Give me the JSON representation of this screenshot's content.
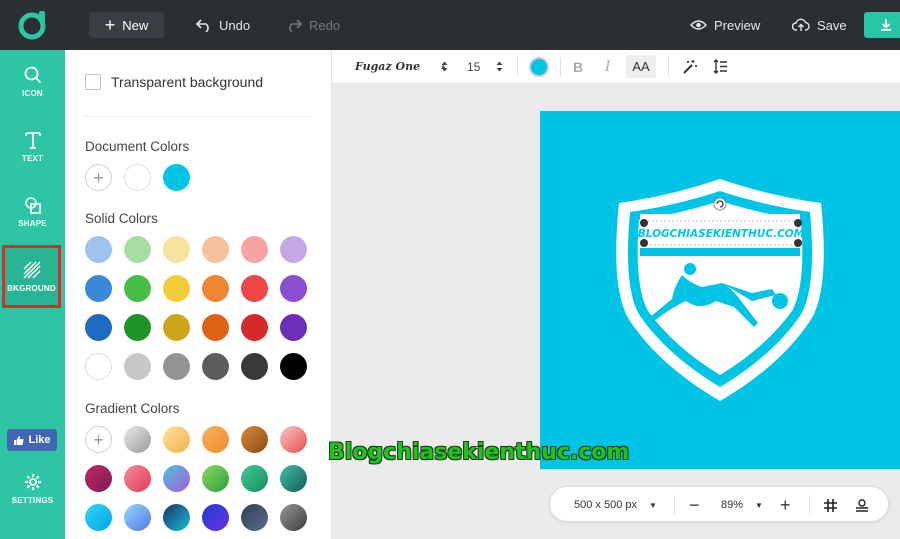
{
  "topbar": {
    "new_label": "New",
    "undo_label": "Undo",
    "redo_label": "Redo",
    "preview_label": "Preview",
    "save_label": "Save",
    "accent_color": "#26c6a6"
  },
  "rail": {
    "items": [
      {
        "label": "ICON",
        "icon": "search-icon"
      },
      {
        "label": "TEXT",
        "icon": "text-icon"
      },
      {
        "label": "SHAPE",
        "icon": "shape-icon"
      },
      {
        "label": "BKGROUND",
        "icon": "background-icon"
      }
    ],
    "like_label": "Like",
    "settings_label": "SETTINGS"
  },
  "panel": {
    "transparent_label": "Transparent background",
    "document_colors_title": "Document Colors",
    "document_colors": [
      "#ffffff",
      "#00c4e6"
    ],
    "solid_colors_title": "Solid Colors",
    "solid_colors": [
      [
        "#9fc3ee",
        "#a6dea1",
        "#f8e2a0",
        "#f7c19d",
        "#f7a3a3",
        "#c4a8e6"
      ],
      [
        "#3b88d8",
        "#46bd46",
        "#f1cd3c",
        "#ee8733",
        "#ec4646",
        "#8a4fcf"
      ],
      [
        "#1f6bbf",
        "#1f9323",
        "#cca71c",
        "#dd6314",
        "#d52a2a",
        "#6a2fb5"
      ],
      [
        "#ffffff",
        "#c8c8c8",
        "#939393",
        "#5c5c5c",
        "#3a3a3a",
        "#000000"
      ]
    ],
    "gradient_colors_title": "Gradient Colors",
    "gradient_colors": [
      [
        null,
        [
          "#e8e8e8",
          "#9a9a9a"
        ],
        [
          "#fde2a0",
          "#f5b04c"
        ],
        [
          "#f7b15d",
          "#ef8d2c"
        ],
        [
          "#d88a3a",
          "#8b4a14"
        ],
        [
          "#f7c9c9",
          "#e84a4a"
        ]
      ],
      [
        [
          "#c2255c",
          "#7a1f5c"
        ],
        [
          "#f78b9a",
          "#e03a5a"
        ],
        [
          "#45c4e0",
          "#b05ad5"
        ],
        [
          "#8fd65e",
          "#2aa03d"
        ],
        [
          "#41cc9a",
          "#1a8a5a"
        ],
        [
          "#3fbfa1",
          "#155a5a"
        ]
      ],
      [
        [
          "#2fd6f5",
          "#00a5e6"
        ],
        [
          "#9ad4f7",
          "#4a7ae8"
        ],
        [
          "#1c2f6b",
          "#18c0d6"
        ],
        [
          "#1c3fd4",
          "#6b2fe0"
        ],
        [
          "#2d3e56",
          "#5a6d8a"
        ],
        [
          "#9a9a9a",
          "#3a3a3a"
        ]
      ]
    ]
  },
  "toolbar": {
    "font_name": "Fugaz One",
    "font_size": "15",
    "text_color": "#00c4e6",
    "bold_label": "B",
    "italic_label": "I",
    "case_label": "AA"
  },
  "canvas": {
    "background_color": "#00c4e6",
    "badge_text": "BLOGCHIASEKIENTHUC.COM",
    "watermark": "Blogchiasekienthuc.com"
  },
  "zoombar": {
    "size_label": "500 x 500 px",
    "zoom_label": "89%"
  }
}
